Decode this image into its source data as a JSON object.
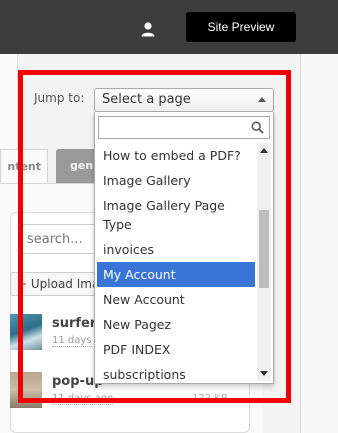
{
  "topbar": {
    "user_icon": "user-icon",
    "site_preview_label": "Site Preview",
    "background": "#3c3c3c"
  },
  "jump": {
    "label": "Jump to:",
    "select_value": "Select a page",
    "search_value": "",
    "items": [
      "How to embed a PDF?",
      "Image Gallery",
      "Image Gallery Page Type",
      "invoices",
      "My Account",
      "New Account",
      "New Pagez",
      "PDF INDEX",
      "subscriptions"
    ],
    "selected_item": "My Account",
    "selected_color": "#3875d7"
  },
  "tabs": [
    {
      "label": "ntent"
    },
    {
      "label": "gen"
    }
  ],
  "files": {
    "search_placeholder": "search...",
    "upload_label": "+ Upload Ima",
    "items": [
      {
        "name": "surfer.",
        "meta": "11 days",
        "size": ""
      },
      {
        "name": "pop-up",
        "meta": "11 days ago",
        "size": "122 KB"
      }
    ]
  },
  "annotation": {
    "highlight_color": "#f30000"
  }
}
